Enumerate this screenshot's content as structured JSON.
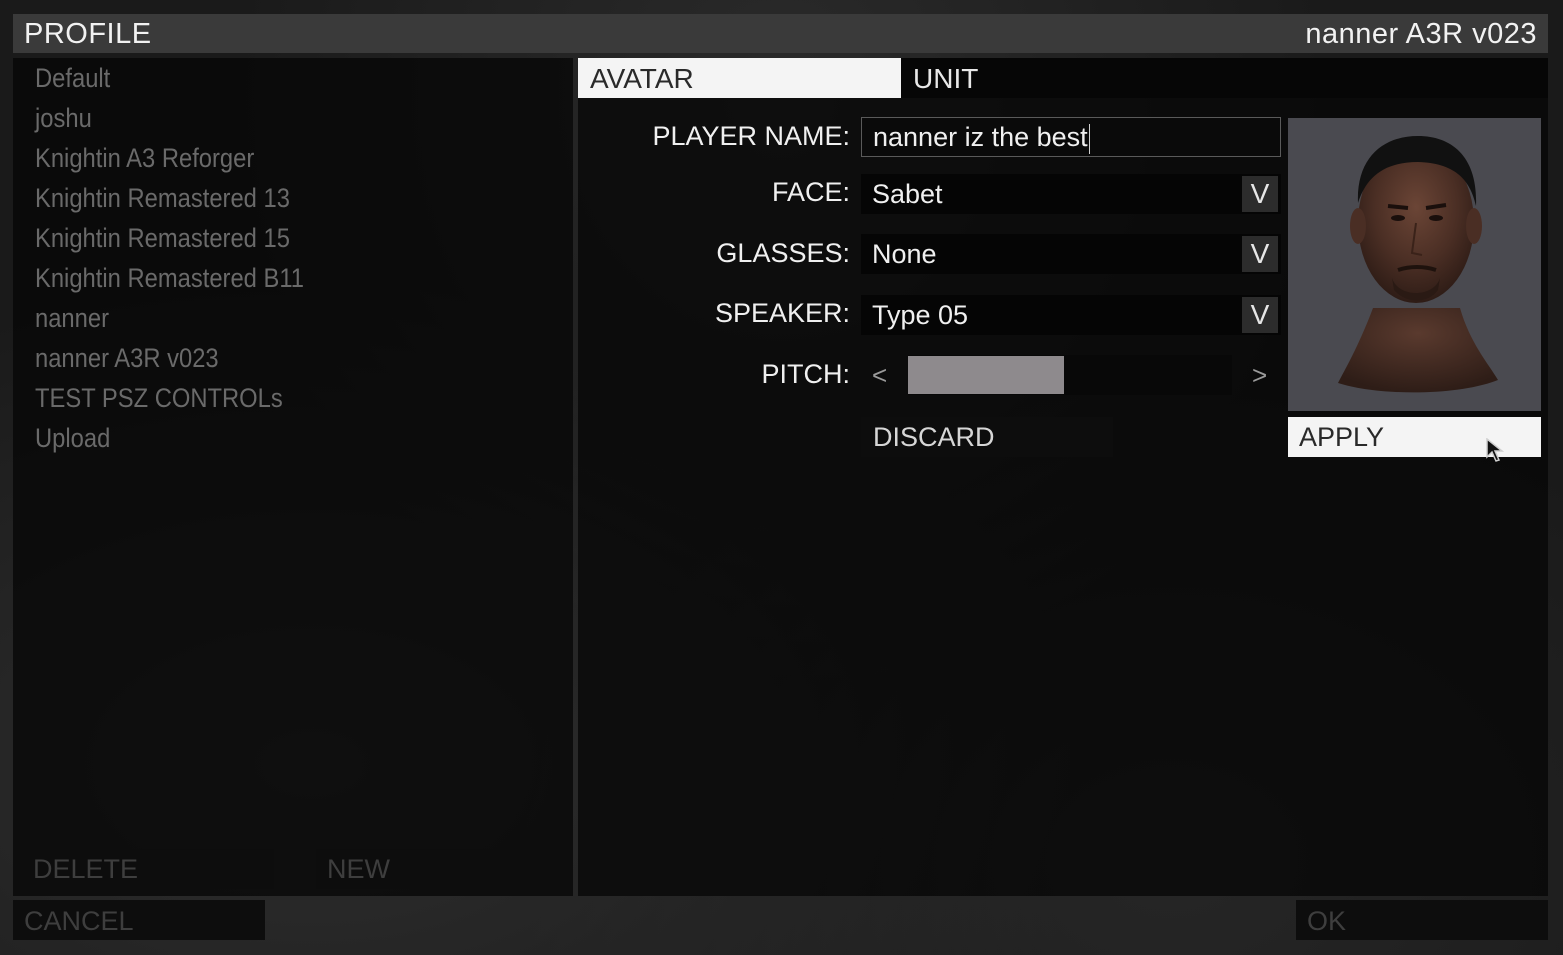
{
  "window": {
    "title": "PROFILE",
    "active_profile": "nanner A3R v023"
  },
  "profiles": [
    "Default",
    "joshu",
    "Knightin A3 Reforger",
    "Knightin Remastered 13",
    "Knightin Remastered 15",
    "Knightin Remastered B11",
    "nanner",
    "nanner A3R v023",
    "TEST PSZ CONTROLs",
    "Upload"
  ],
  "list_actions": {
    "delete_label": "DELETE",
    "new_label": "NEW"
  },
  "tabs": {
    "avatar_label": "AVATAR",
    "unit_label": "UNIT",
    "active": "AVATAR"
  },
  "form": {
    "player_name_label": "PLAYER NAME:",
    "player_name_value": "nanner iz the best",
    "face_label": "FACE:",
    "face_value": "Sabet",
    "glasses_label": "GLASSES:",
    "glasses_value": "None",
    "speaker_label": "SPEAKER:",
    "speaker_value": "Type 05",
    "pitch_label": "PITCH:",
    "pitch_fraction": 0.48,
    "dropdown_glyph": "V",
    "pitch_left_glyph": "<",
    "pitch_right_glyph": ">",
    "discard_label": "DISCARD",
    "apply_label": "APPLY"
  },
  "footer": {
    "cancel_label": "CANCEL",
    "ok_label": "OK"
  },
  "colors": {
    "active_tab_bg": "#f4f4f4",
    "titlebar_bg": "#3a3a3a",
    "pitch_fill": "#8e8a8d"
  }
}
